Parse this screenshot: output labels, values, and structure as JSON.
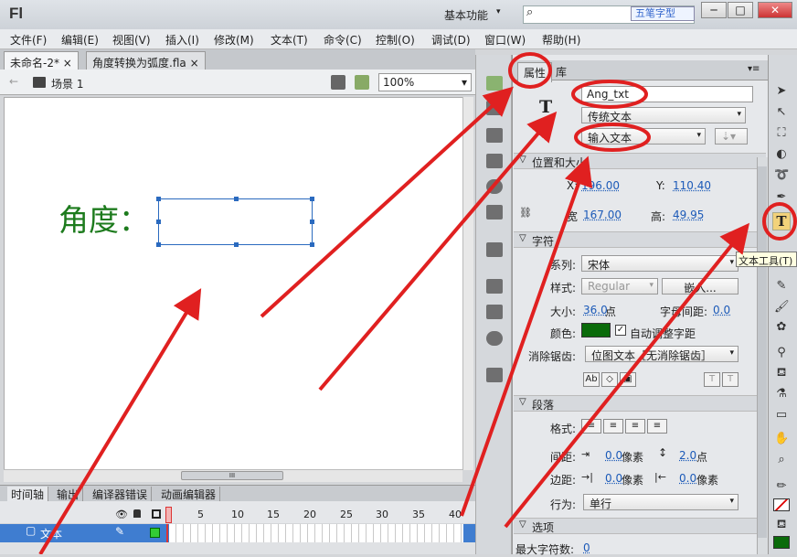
{
  "app": {
    "logo": "Fl",
    "workspace": "基本功能",
    "workspace_arrow": "▾",
    "search_placeholder": "",
    "watermark": "五笔字型"
  },
  "window_buttons": [
    "─",
    "□",
    "✕"
  ],
  "menu": [
    "文件(F)",
    "编辑(E)",
    "视图(V)",
    "插入(I)",
    "修改(M)",
    "文本(T)",
    "命令(C)",
    "控制(O)",
    "调试(D)",
    "窗口(W)",
    "帮助(H)"
  ],
  "doc_tabs": [
    {
      "label": "未命名-2*",
      "close": "×"
    },
    {
      "label": "角度转换为弧度.fla",
      "close": "×"
    }
  ],
  "scene": {
    "back_icon": "←",
    "name": "场景 1",
    "zoom": "100%",
    "zoom_arrow": "▾"
  },
  "stage": {
    "label": "角度：",
    "scroll_grip": "III"
  },
  "timeline": {
    "tabs": [
      "时间轴",
      "输出",
      "编译器错误",
      "动画编辑器"
    ],
    "ticks": [
      "1",
      "5",
      "10",
      "15",
      "20",
      "25",
      "30",
      "35",
      "40"
    ],
    "layer": "文本"
  },
  "props": {
    "tabs": [
      "属性",
      "库"
    ],
    "instance_name": "Ang_txt",
    "text_type": "传统文本",
    "text_mode": "输入文本",
    "section_position": "位置和大小",
    "x_label": "X:",
    "x_val": "196.00",
    "y_label": "Y:",
    "y_val": "110.40",
    "w_label": "宽",
    "w_val": "167.00",
    "h_label": "高:",
    "h_val": "49.95",
    "section_char": "字符",
    "family_label": "系列:",
    "family_val": "宋体",
    "style_label": "样式:",
    "style_val": "Regular",
    "embed_btn": "嵌入...",
    "size_label": "大小:",
    "size_val": "36.0",
    "size_unit": "点",
    "spacing_label": "字母间距:",
    "spacing_val": "0.0",
    "color_label": "颜色:",
    "autokern": "自动调整字距",
    "check": "✓",
    "aa_label": "消除锯齿:",
    "aa_val": "位图文本［无消除锯齿］",
    "section_para": "段落",
    "format_label": "格式:",
    "gap_label": "间距:",
    "gap_val1": "0.0",
    "gap_unit1": "像素",
    "gap_val2": "2.0",
    "gap_unit2": "点",
    "margin_label": "边距:",
    "margin_val1": "0.0",
    "margin_unit1": "像素",
    "margin_val2": "0.0",
    "margin_unit2": "像素",
    "behavior_label": "行为:",
    "behavior_val": "单行",
    "section_options": "选项",
    "maxchars_label": "最大字符数:",
    "maxchars_val": "0"
  },
  "tooltip": "文本工具(T)",
  "colors": {
    "stage_text": "#1d7b1d",
    "fill": "#0a6b0a",
    "annotation": "#e02020"
  }
}
